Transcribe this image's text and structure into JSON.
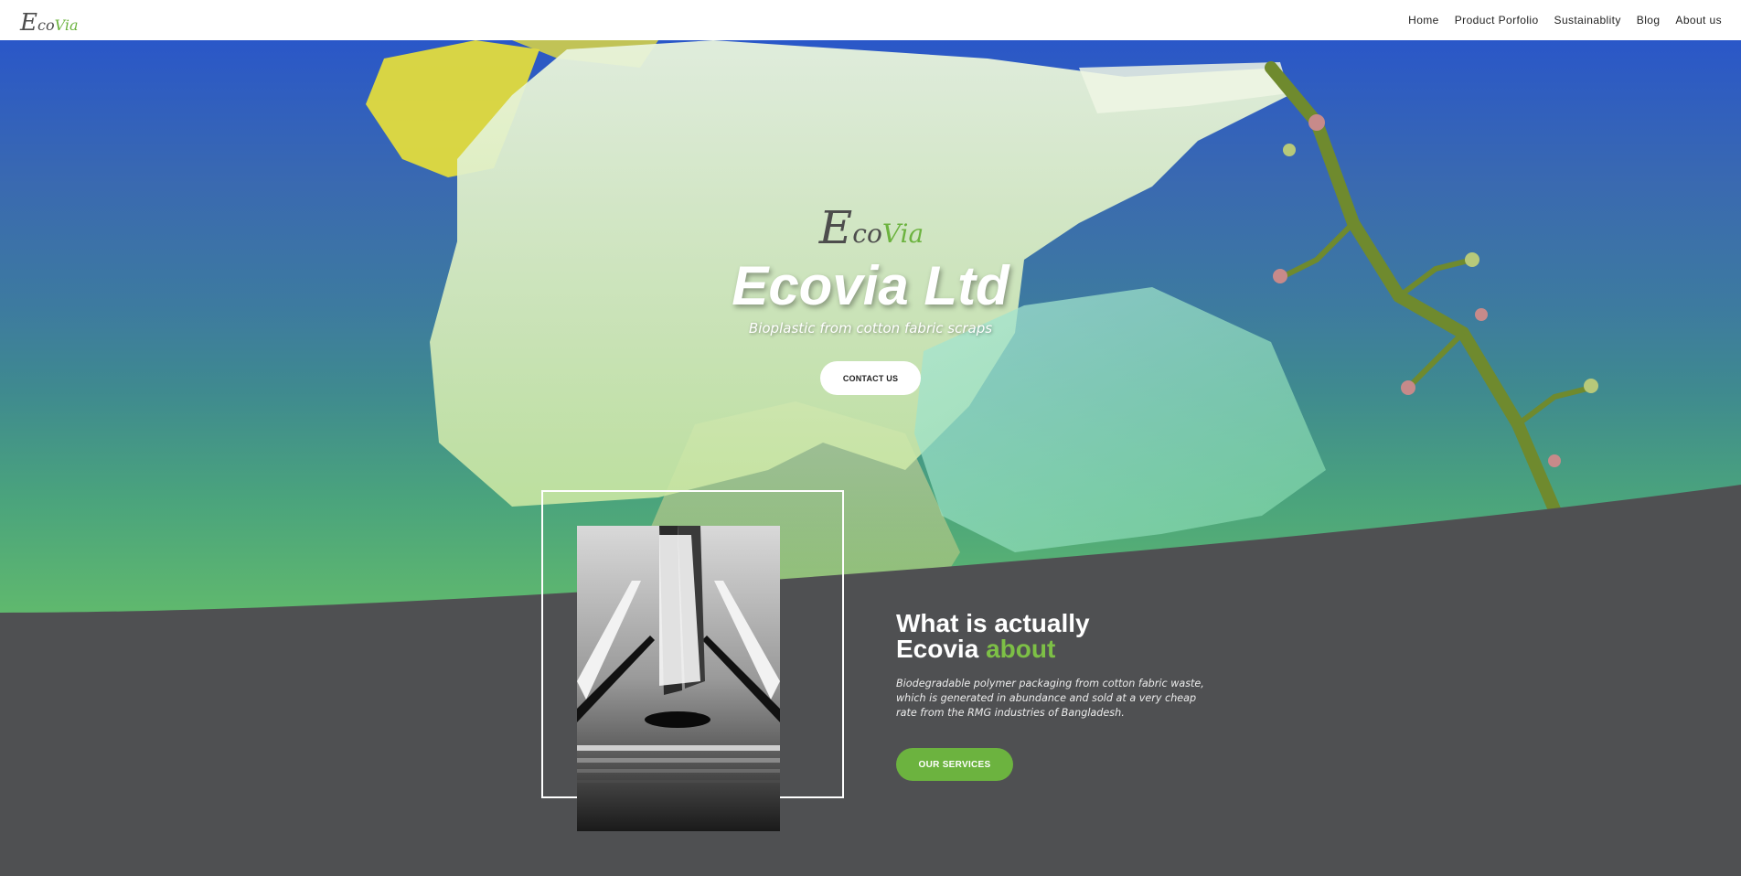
{
  "nav": {
    "logo": {
      "e": "E",
      "co": "co",
      "via": "Via"
    },
    "items": [
      {
        "label": "Home"
      },
      {
        "label": "Product Porfolio"
      },
      {
        "label": "Sustainablity"
      },
      {
        "label": "Blog"
      },
      {
        "label": "About us"
      }
    ]
  },
  "hero": {
    "logo": {
      "e": "E",
      "co": "co",
      "via": "Via"
    },
    "title": "Ecovia Ltd",
    "subtitle": "Bioplastic from cotton fabric scraps",
    "contact_label": "CONTACT US"
  },
  "about": {
    "heading_line1": "What is actually",
    "heading_brand": "Ecovia",
    "heading_accent": "about",
    "text": "Biodegradable polymer packaging from cotton fabric waste, which is generated in abundance and sold at a very cheap rate from the RMG industries of Bangladesh.",
    "services_label": "OUR SERVICES"
  },
  "colors": {
    "brand_green": "#6cb33f",
    "accent_green": "#7dc046",
    "section_grey": "#4f5052",
    "logo_grey": "#4d4d4d"
  }
}
